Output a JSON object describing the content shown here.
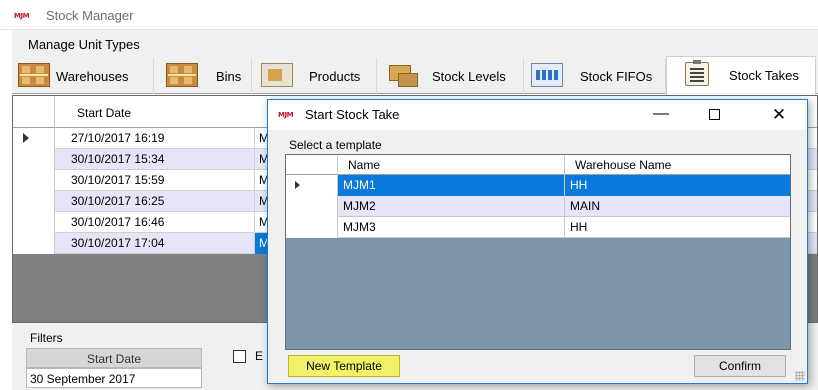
{
  "app": {
    "logo": "MJM",
    "title": "Stock Manager",
    "menu": [
      "Manage Unit Types"
    ]
  },
  "tabs": [
    {
      "label": "Warehouses",
      "icon": "warehouse-shelf-icon"
    },
    {
      "label": "Bins",
      "icon": "bins-shelf-icon"
    },
    {
      "label": "Products",
      "icon": "product-box-icon"
    },
    {
      "label": "Stock Levels",
      "icon": "stock-boxes-icon"
    },
    {
      "label": "Stock FIFOs",
      "icon": "fifo-rack-icon"
    },
    {
      "label": "Stock Takes",
      "icon": "clipboard-icon",
      "active": true
    }
  ],
  "background_grid": {
    "columns": [
      "Start Date",
      "M"
    ],
    "rows": [
      {
        "start_date": "27/10/2017 16:19",
        "col2": "M",
        "current": true
      },
      {
        "start_date": "30/10/2017 15:34",
        "col2": "M"
      },
      {
        "start_date": "30/10/2017 15:59",
        "col2": "M"
      },
      {
        "start_date": "30/10/2017 16:25",
        "col2": "M"
      },
      {
        "start_date": "30/10/2017 16:46",
        "col2": "M"
      },
      {
        "start_date": "30/10/2017 17:04",
        "col2": "M",
        "selected": true
      }
    ]
  },
  "filters": {
    "label": "Filters",
    "start_date_header": "Start Date",
    "start_date_value": "30 September 2017",
    "checkbox_label": "E",
    "checkbox_checked": false
  },
  "dialog": {
    "logo": "MJM",
    "title": "Start Stock Take",
    "select_label": "Select a template",
    "columns": [
      "Name",
      "Warehouse Name"
    ],
    "rows": [
      {
        "name": "MJM1",
        "warehouse": "HH",
        "selected": true
      },
      {
        "name": "MJM2",
        "warehouse": "MAIN"
      },
      {
        "name": "MJM3",
        "warehouse": "HH"
      }
    ],
    "new_template_label": "New Template",
    "confirm_label": "Confirm",
    "minimize_glyph": "—",
    "close_glyph": "✕"
  },
  "colors": {
    "selection": "#0a79d9",
    "alt_row": "#e5e5f7",
    "grid_background": "#808080",
    "dialog_grid_background": "#7e94ab",
    "highlight_button": "#f2f267",
    "logo": "#c0152a"
  }
}
